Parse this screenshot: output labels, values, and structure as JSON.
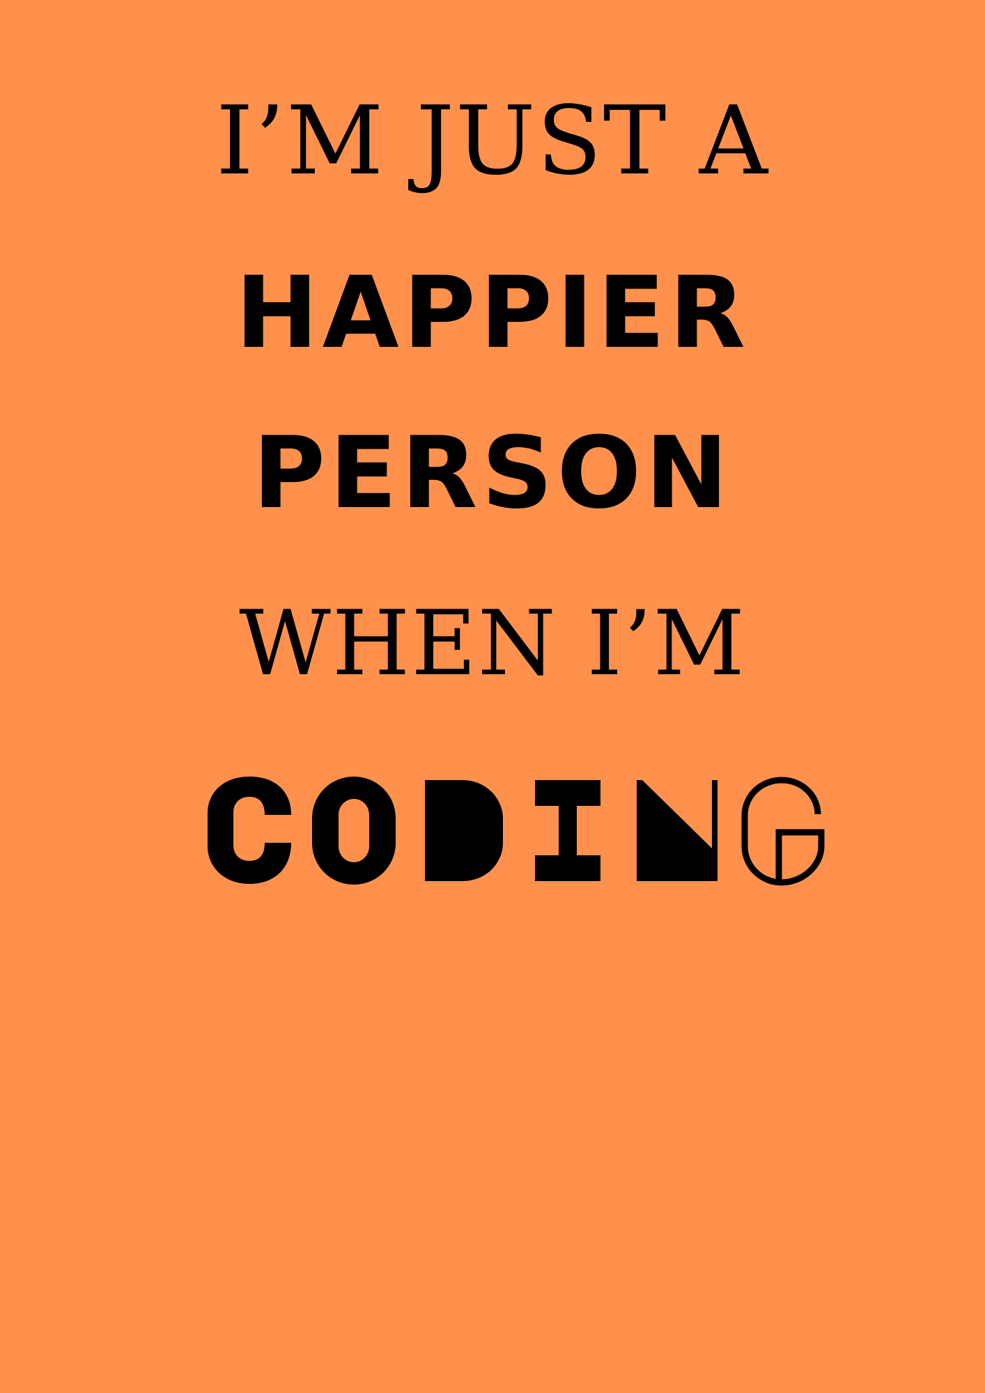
{
  "background_color": "#FF914D",
  "text_color": "#000000",
  "poster": {
    "line1": "I’M JUST A",
    "line2": "HAPPIER",
    "line3": "PERSON",
    "line4": "WHEN I’M",
    "line5": "CODING",
    "line5_letters": [
      "C",
      "O",
      "D",
      "I",
      "N",
      "G"
    ]
  }
}
